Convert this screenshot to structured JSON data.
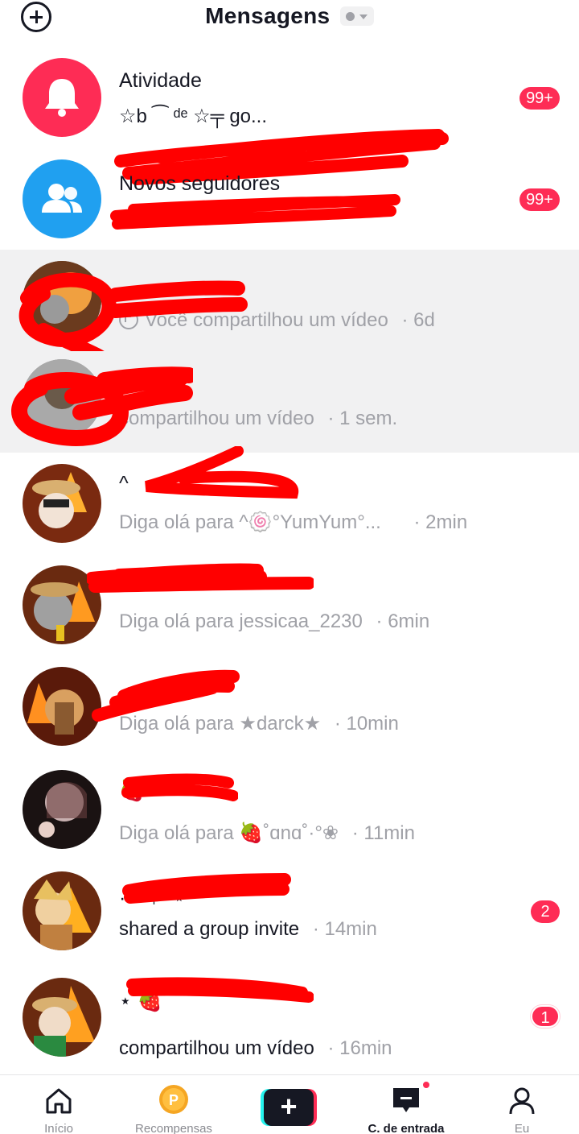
{
  "header": {
    "title": "Mensagens"
  },
  "rows": [
    {
      "name": "Atividade",
      "subtitle": "☆b                   ⁀ ᵈᵉ            ☆╤ go...",
      "badge": "99+"
    },
    {
      "name": "Novos seguidores",
      "subtitle": "Kel                                          te.",
      "badge": "99+"
    },
    {
      "name": "",
      "subtitle": "Você compartilhou um vídeo",
      "time": "· 6d"
    },
    {
      "name": "",
      "subtitle": "compartilhou um vídeo",
      "time": "· 1 sem."
    },
    {
      "name": "^",
      "subtitle": "Diga olá para ^🍥°YumYum°...",
      "time": "· 2min"
    },
    {
      "name": "",
      "subtitle": "Diga olá para jessicaa_2230",
      "time": "· 6min"
    },
    {
      "name": "★",
      "subtitle": "Diga olá para ★darck★",
      "time": "· 10min"
    },
    {
      "name": "🍓",
      "subtitle": "Diga olá para 🍓˚ɑnɑ˚·°❀",
      "time": "· 11min"
    },
    {
      "name": "·                 ᵗⁿ ₊ °⋆",
      "subtitle": "shared a group invite",
      "time": "· 14min",
      "badge": "2"
    },
    {
      "name": "⋆                              🍓",
      "subtitle": "compartilhou um vídeo",
      "time": "· 16min",
      "badge": "1"
    }
  ],
  "nav": {
    "home": "Início",
    "rewards": "Recompensas",
    "inbox": "C. de entrada",
    "profile": "Eu"
  },
  "colors": {
    "accent": "#fe2c55",
    "blue": "#20a0f0",
    "redaction": "#ff0000"
  },
  "icons": [
    "add-circle-icon",
    "bell-icon",
    "users-icon",
    "share-icon",
    "home-icon",
    "rewards-coin-icon",
    "plus-icon",
    "inbox-icon",
    "profile-icon"
  ]
}
